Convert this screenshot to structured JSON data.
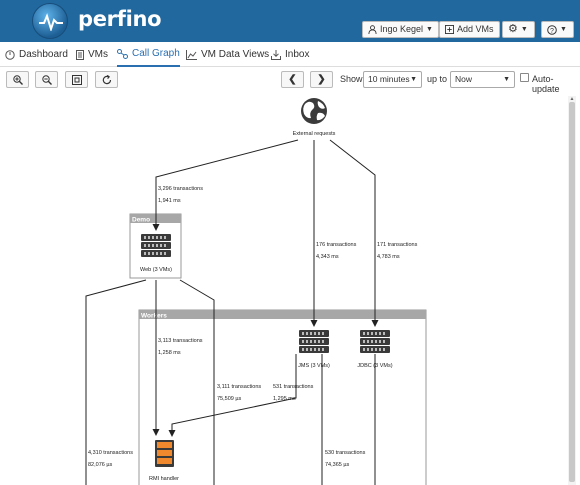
{
  "app": {
    "brand": "perfino"
  },
  "header": {
    "user_label": "Ingo Kegel",
    "add_vms_label": "Add VMs",
    "settings_icon": "gear-icon",
    "help_icon": "help-icon"
  },
  "nav": {
    "tabs": [
      {
        "label": "Dashboard",
        "icon": "dashboard-icon"
      },
      {
        "label": "VMs",
        "icon": "vms-icon"
      },
      {
        "label": "Call Graph",
        "icon": "call-graph-icon",
        "active": true
      },
      {
        "label": "VM Data Views",
        "icon": "chart-icon"
      },
      {
        "label": "Inbox",
        "icon": "inbox-icon"
      }
    ]
  },
  "toolbar": {
    "show_label": "Show",
    "show_value": "10 minutes",
    "upto_label": "up to",
    "upto_value": "Now",
    "autoupdate_label": "Auto-update"
  },
  "graph": {
    "external_label": "External requests",
    "groups": {
      "demo": "Demo",
      "workers": "Workers"
    },
    "nodes": {
      "web": "Web (3 VMs)",
      "jms": "JMS (3 VMs)",
      "jdbc": "JDBC (3 VMs)",
      "rmi": "RMI handler"
    },
    "edges": {
      "e1_tx": "3,296 transactions",
      "e1_ms": "1,941 ms",
      "e2_tx": "176 transactions",
      "e2_ms": "4,343 ms",
      "e3_tx": "171 transactions",
      "e3_ms": "4,783 ms",
      "e4_tx": "3,113 transactions",
      "e4_ms": "1,258 ms",
      "e5_tx": "3,111 transactions",
      "e5_ms": "75,509 µs",
      "e6_tx": "531 transactions",
      "e6_ms": "1,295 ms",
      "e7_tx": "4,310 transactions",
      "e7_ms": "82,076 µs",
      "e8_tx": "530 transactions",
      "e8_ms": "74,365 µs"
    }
  }
}
